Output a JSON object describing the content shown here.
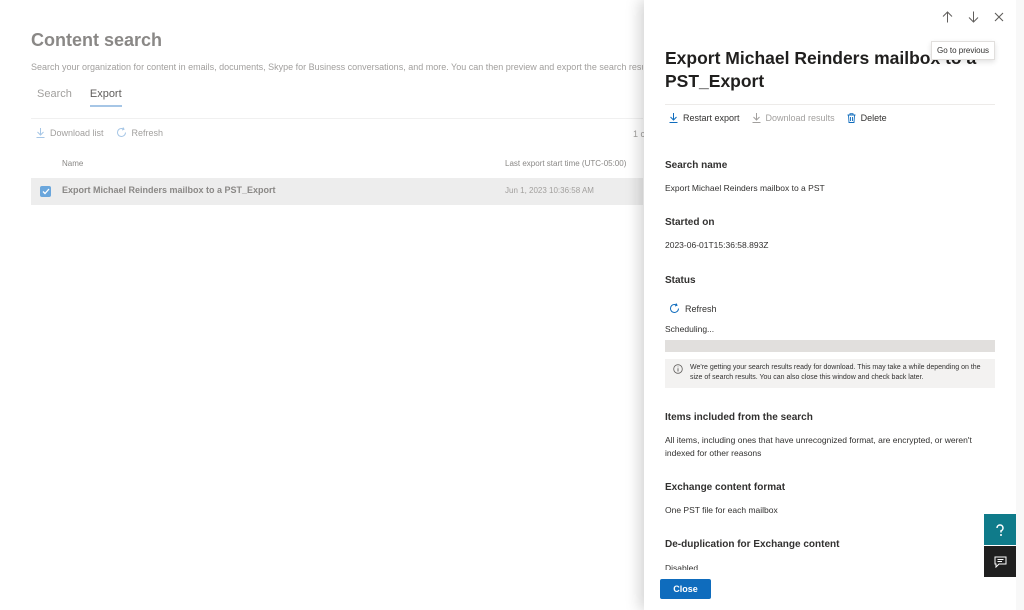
{
  "background": {
    "title": "Content search",
    "description": "Search your organization for content in emails, documents, Skype for Business conversations, and more. You can then preview and export the search results.",
    "tabs": [
      {
        "label": "Search",
        "active": false
      },
      {
        "label": "Export",
        "active": true
      }
    ],
    "toolbar": {
      "download_list": "Download list",
      "refresh": "Refresh"
    },
    "count": "1 c",
    "columns": {
      "name": "Name",
      "last_export": "Last export start time (UTC-05:00)"
    },
    "rows": [
      {
        "name": "Export Michael Reinders mailbox to a PST_Export",
        "time": "Jun 1, 2023 10:36:58 AM",
        "selected": true
      }
    ]
  },
  "panel": {
    "tooltip": "Go to previous",
    "title": "Export Michael Reinders mailbox to a PST_Export",
    "toolbar": {
      "restart": "Restart export",
      "download": "Download results",
      "delete": "Delete"
    },
    "search_name_label": "Search name",
    "search_name_value": "Export Michael Reinders mailbox to a PST",
    "started_label": "Started on",
    "started_value": "2023-06-01T15:36:58.893Z",
    "status_label": "Status",
    "status_refresh": "Refresh",
    "status_text": "Scheduling...",
    "progress_fraction": 0.0,
    "info_text": "We're getting your search results ready for download. This may take a while depending on the size of search results. You can also close this window and check back later.",
    "items_label": "Items included from the search",
    "items_value": "All items, including ones that have unrecognized format, are encrypted, or weren't indexed for other reasons",
    "format_label": "Exchange content format",
    "format_value": "One PST file for each mailbox",
    "dedup_label": "De-duplication for Exchange content",
    "dedup_value": "Disabled",
    "close_label": "Close"
  },
  "colors": {
    "accent": "#0f6cbd",
    "fab_teal": "#0f7b8a",
    "fab_dark": "#1f1f1f"
  }
}
